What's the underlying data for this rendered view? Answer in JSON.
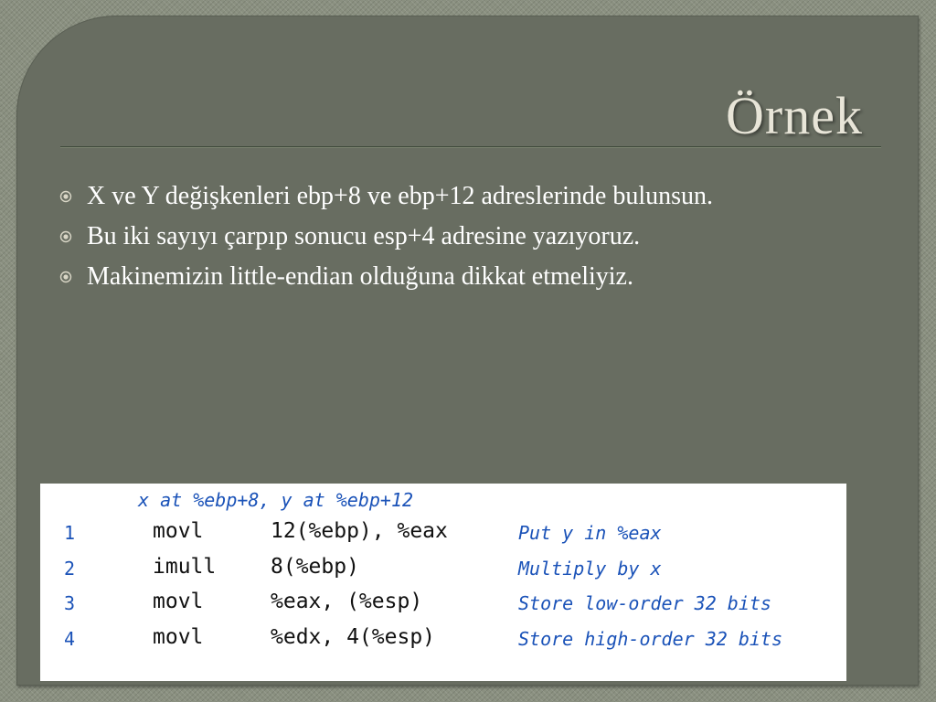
{
  "slide": {
    "title": "Örnek",
    "bullets": [
      "X ve Y değişkenleri  ebp+8 ve ebp+12 adreslerinde bulunsun.",
      "Bu iki sayıyı çarpıp sonucu esp+4 adresine yazıyoruz.",
      "Makinemizin little-endian olduğuna dikkat etmeliyiz."
    ],
    "bullet_icon": "circle-target-icon"
  },
  "code": {
    "header": "x at %ebp+8, y at %ebp+12",
    "rows": [
      {
        "line": "1",
        "instr": "movl",
        "operands": "12(%ebp), %eax",
        "comment": "Put y in %eax"
      },
      {
        "line": "2",
        "instr": "imull",
        "operands": "8(%ebp)",
        "comment": "Multiply by x"
      },
      {
        "line": "3",
        "instr": "movl",
        "operands": "%eax, (%esp)",
        "comment": "Store low-order 32 bits"
      },
      {
        "line": "4",
        "instr": "movl",
        "operands": "%edx, 4(%esp)",
        "comment": "Store high-order 32 bits"
      }
    ]
  },
  "colors": {
    "slide_bg": "#686d61",
    "title_text": "#e8e5d8",
    "code_accent": "#1a52b8"
  }
}
